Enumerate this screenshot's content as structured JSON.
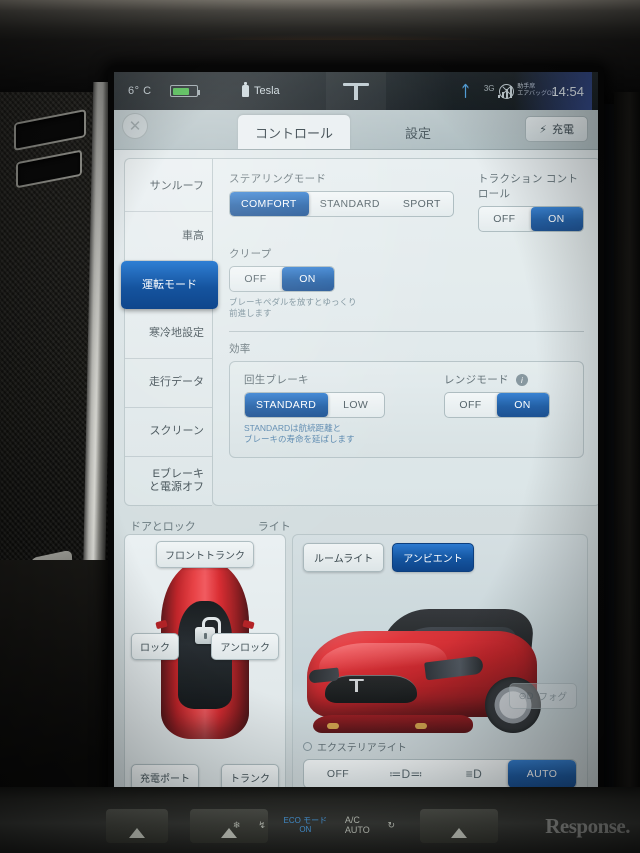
{
  "statusbar": {
    "temperature": "6° C",
    "battery_icon": "battery-icon",
    "usb_label": "Tesla",
    "usb_icon": "usb-device-icon",
    "tesla_logo": "tesla-t-logo",
    "bluetooth_icon": "bluetooth-icon",
    "network_generation": "3G",
    "signal_icon": "signal-bars-icon",
    "airbag_icon": "airbag-off-icon",
    "airbag_line1": "助手席",
    "airbag_line2": "エアバッグ",
    "airbag_status": "ON",
    "clock": "14:54"
  },
  "tabs": {
    "close_icon": "close-icon",
    "items": [
      {
        "label": "コントロール",
        "active": true
      },
      {
        "label": "設定",
        "active": false
      }
    ],
    "charge_button": {
      "label": "充電",
      "icon": "lightning-bolt-icon"
    }
  },
  "sidebar": {
    "items": [
      {
        "label": "サンルーフ",
        "active": false
      },
      {
        "label": "車高",
        "active": false
      },
      {
        "label": "運転モード",
        "active": true
      },
      {
        "label": "寒冷地設定",
        "active": false
      },
      {
        "label": "走行データ",
        "active": false
      },
      {
        "label": "スクリーン",
        "active": false
      },
      {
        "label": "Eブレーキ\nと電源オフ",
        "active": false
      }
    ]
  },
  "controls": {
    "steering_mode": {
      "label": "ステアリングモード",
      "options": [
        "COMFORT",
        "STANDARD",
        "SPORT"
      ],
      "selected": "COMFORT"
    },
    "traction_control": {
      "label": "トラクション コントロール",
      "options": [
        "OFF",
        "ON"
      ],
      "selected": "ON"
    },
    "creep": {
      "label": "クリープ",
      "options": [
        "OFF",
        "ON"
      ],
      "selected": "ON",
      "hint": "ブレーキペダルを放すとゆっくり\n前進します"
    },
    "efficiency": {
      "label": "効率",
      "regen_brake": {
        "label": "回生ブレーキ",
        "options": [
          "STANDARD",
          "LOW"
        ],
        "selected": "STANDARD",
        "hint": "STANDARDは航続距離と\nブレーキの寿命を延ばします"
      },
      "range_mode": {
        "label": "レンジモード",
        "info_icon": "info-icon",
        "options": [
          "OFF",
          "ON"
        ],
        "selected": "ON"
      }
    }
  },
  "bottom": {
    "tabs": [
      {
        "label": "ドアとロック"
      },
      {
        "label": "ライト"
      }
    ],
    "doors": {
      "car_icon": "car-top-view-icon",
      "lock_icon": "unlocked-padlock-icon",
      "buttons": {
        "front_trunk": "フロントトランク",
        "lock": "ロック",
        "unlock": "アンロック",
        "charge_port": "充電ポート",
        "trunk": "トランク"
      }
    },
    "lights": {
      "car_icon": "model-s-front-view-icon",
      "buttons": [
        {
          "label": "ルームライト",
          "active": false
        },
        {
          "label": "アンビエント",
          "active": true
        }
      ],
      "fog_button": {
        "label": "フォグ",
        "icon": "fog-light-icon",
        "disabled": true
      },
      "exterior": {
        "label": "エクステリアライト",
        "icon": "sun-icon",
        "options": [
          "OFF",
          "parking-light-icon",
          "headlight-icon",
          "AUTO"
        ],
        "selected": "AUTO",
        "off_label": "OFF",
        "auto_label": "AUTO"
      }
    }
  },
  "hardware": {
    "fan_icon": "fan-icon",
    "defrost_icon": "defrost-icon",
    "seat_heat_icon": "seat-heater-icon",
    "eco_label": "ECO モード",
    "eco_status": "ON",
    "ac_label": "A/C",
    "auto_label": "AUTO",
    "recirc_icon": "recirculate-icon",
    "watermark": "Response."
  },
  "colors": {
    "accent_blue": "#14549f",
    "screen_bg": "#d4dee0",
    "status_bg": "#0a1014",
    "car_red": "#c2171c"
  }
}
